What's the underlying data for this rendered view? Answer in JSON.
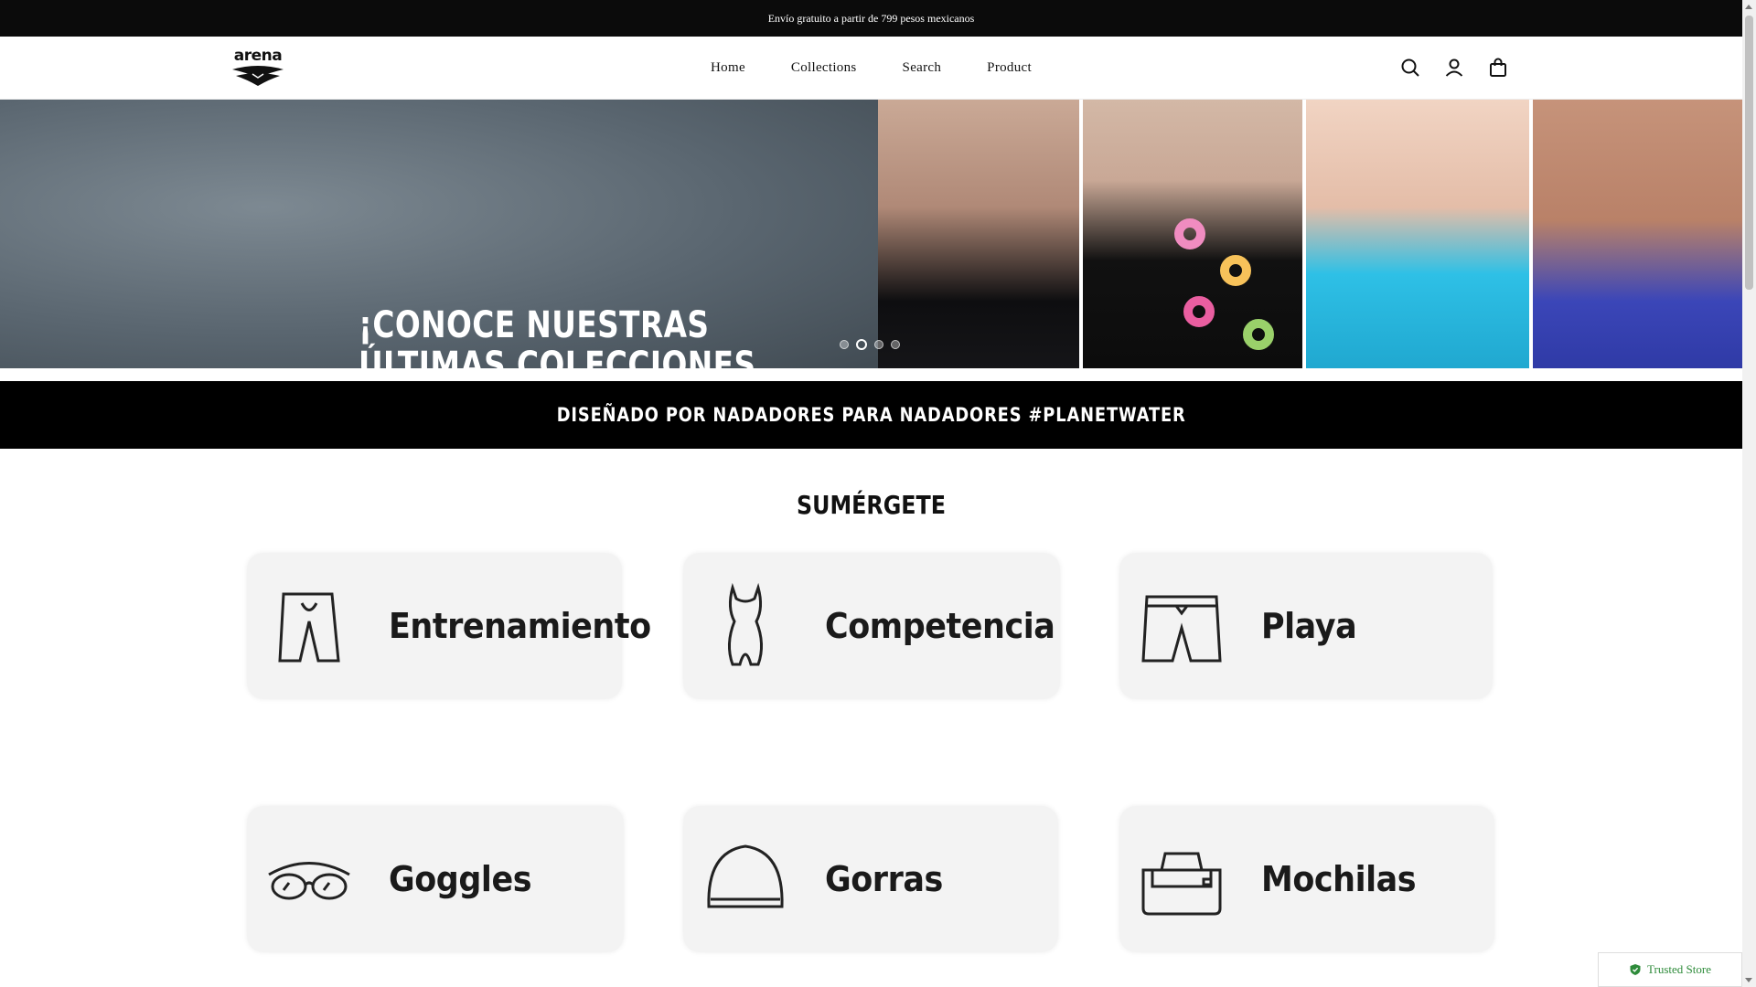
{
  "announcement": {
    "text": "Envío gratuito a partir de 799 pesos mexicanos"
  },
  "header": {
    "logo_text": "arena",
    "nav": [
      {
        "label": "Home"
      },
      {
        "label": "Collections"
      },
      {
        "label": "Search"
      },
      {
        "label": "Product"
      }
    ],
    "icons": [
      "search-icon",
      "account-icon",
      "cart-icon"
    ]
  },
  "hero": {
    "headline_line1": "¡CONOCE NUESTRAS",
    "headline_line2": "ÚLTIMAS COLECCIONES",
    "slides": {
      "count": 4,
      "active": 2
    }
  },
  "banner": {
    "text": "DISEÑADO POR NADADORES PARA NADADORES #PLANETWATER"
  },
  "section": {
    "title": "SUMÉRGETE",
    "cards": [
      {
        "label": "Entrenamiento",
        "icon": "jammer-icon"
      },
      {
        "label": "Competencia",
        "icon": "swimsuit-icon"
      },
      {
        "label": "Playa",
        "icon": "boardshorts-icon"
      },
      {
        "label": "Goggles",
        "icon": "goggles-icon"
      },
      {
        "label": "Gorras",
        "icon": "swim-cap-icon"
      },
      {
        "label": "Mochilas",
        "icon": "duffel-bag-icon"
      }
    ]
  },
  "trusted": {
    "label": "Trusted Store"
  },
  "colors": {
    "black": "#0b0b0b",
    "card_bg": "#f3f3f3",
    "trusted_green": "#2e8b3a"
  }
}
